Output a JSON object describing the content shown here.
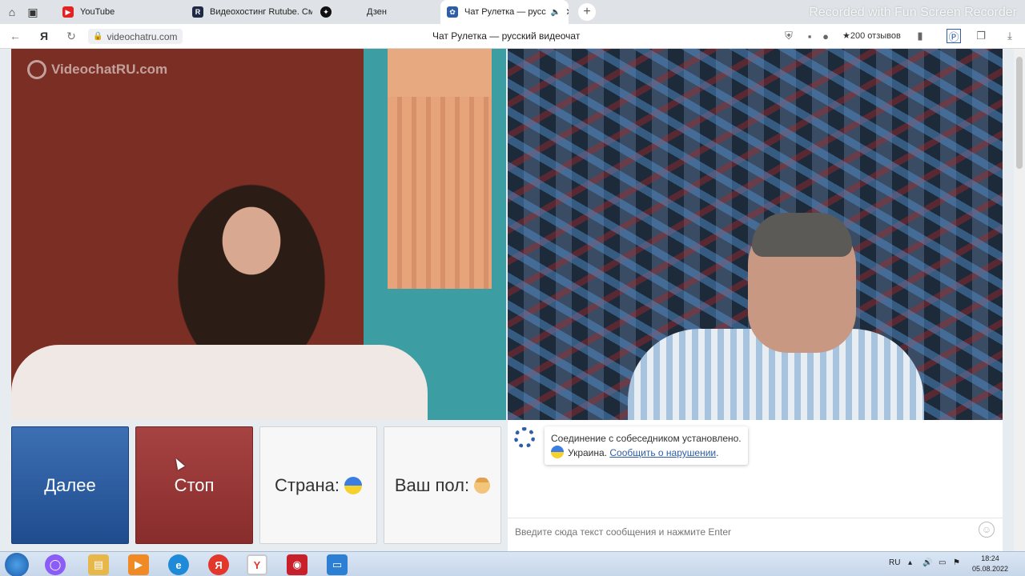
{
  "browser": {
    "tabs": [
      {
        "label": "YouTube",
        "icon": "youtube-icon"
      },
      {
        "label": "Видеохостинг Rutube. Смо",
        "icon": "rutube-icon"
      },
      {
        "label": "Дзен",
        "icon": "dzen-icon"
      },
      {
        "label": "Чат Рулетка — русс",
        "icon": "videochat-icon",
        "active": true
      }
    ],
    "url": "videochatru.com",
    "page_title": "Чат Рулетка — русский видеочат",
    "reviews": "200 отзывов",
    "recorder_overlay": "Recorded with Fun Screen Recorder"
  },
  "video": {
    "watermark": "VideochatRU.com"
  },
  "controls": {
    "next_label": "Далее",
    "stop_label": "Стоп",
    "country_label": "Страна:",
    "gender_label": "Ваш пол:"
  },
  "chat": {
    "connection_message": "Соединение с собеседником установлено.",
    "country_name": "Украина.",
    "report_link": "Сообщить о нарушении",
    "report_suffix": ".",
    "input_placeholder": "Введите сюда текст сообщения и нажмите Enter"
  },
  "taskbar": {
    "language": "RU",
    "time": "18:24",
    "date": "05.08.2022"
  },
  "colors": {
    "next_button": "#2d5ea3",
    "stop_button": "#9a3a39",
    "link": "#2f5ea6"
  }
}
